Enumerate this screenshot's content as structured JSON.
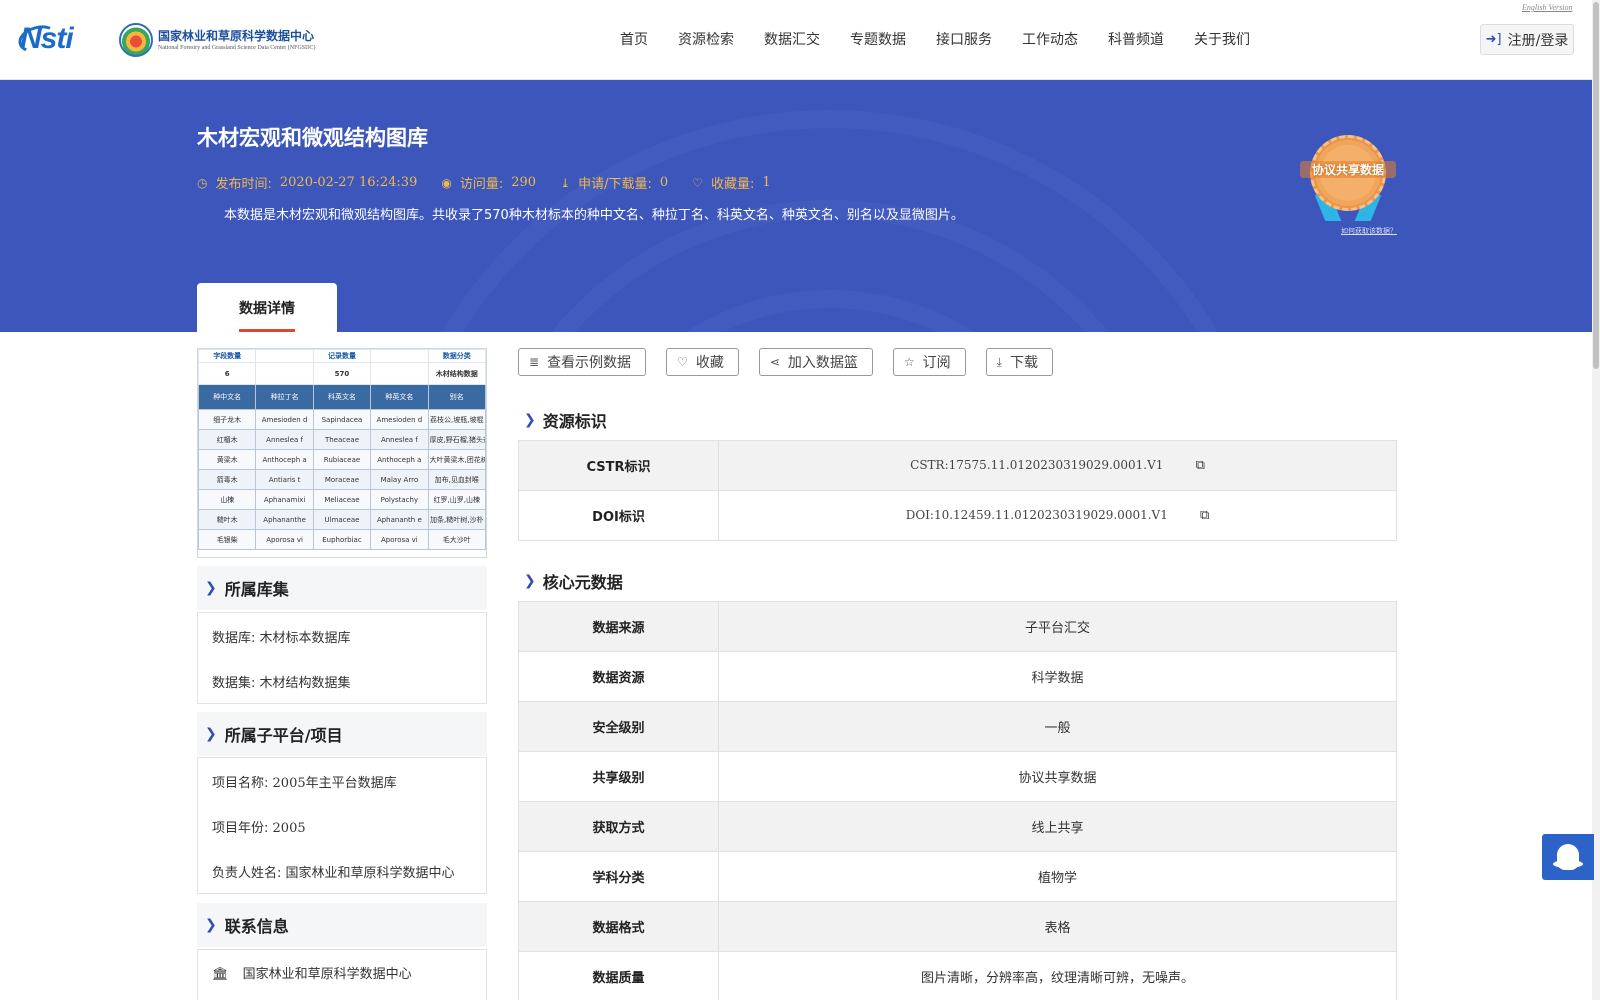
{
  "header": {
    "logo_nsti": "Nsti",
    "logo_cn": "国家林业和草原科学数据中心",
    "logo_en": "National Forestry and Grassland Science Data Center (NFGSDC)",
    "english_link": "English Version",
    "nav": [
      "首页",
      "资源检索",
      "数据汇交",
      "专题数据",
      "接口服务",
      "工作动态",
      "科普频道",
      "关于我们"
    ],
    "login_label": "注册/登录"
  },
  "banner": {
    "title": "木材宏观和微观结构图库",
    "publish_label": "发布时间:",
    "publish_value": "2020-02-27 16:24:39",
    "visits_label": "访问量:",
    "visits_value": "290",
    "downloads_label": "申请/下载量:",
    "downloads_value": "0",
    "favorites_label": "收藏量:",
    "favorites_value": "1",
    "description": "本数据是木材宏观和微观结构图库。共收录了570种木材标本的种中文名、种拉丁名、科英文名、种英文名、别名以及显微图片。",
    "badge_text": "协议共享数据",
    "badge_link": "如何获取该数据？",
    "tab_label": "数据详情"
  },
  "thumbnail": {
    "summary_labels": [
      "字段数量",
      "记录数量",
      "数据分类"
    ],
    "summary_values": [
      "6",
      "570",
      "木材结构数据"
    ],
    "headers": [
      "种中文名",
      "种拉丁名",
      "科英文名",
      "种英文名",
      "别名"
    ],
    "rows": [
      [
        "细子龙木",
        "Amesioden d",
        "Sapindacea",
        "Amesioden d",
        "荔枝公,坡瓶,坡棍"
      ],
      [
        "红楣木",
        "Anneslea f",
        "Theaceae",
        "Anneslea f",
        "厚皮,野石榴,猪头茶"
      ],
      [
        "黄梁木",
        "Anthoceph a",
        "Rubiaceae",
        "Anthoceph a",
        "大叶黄梁木,团花树"
      ],
      [
        "箭毒木",
        "Antiaris t",
        "Moraceae",
        "Malay Arro",
        "加布,见血封喉"
      ],
      [
        "山楝",
        "Aphanamixi",
        "Meliaceae",
        "Polystachy",
        "红罗,山罗,山楝"
      ],
      [
        "糙叶木",
        "Aphananthe",
        "Ulmaceae",
        "Aphananth e",
        "加条,糙叶树,沙朴"
      ],
      [
        "毛银柴",
        "Aporosa vi",
        "Euphorbiac",
        "Aporosa vi",
        "毛大沙叶"
      ]
    ]
  },
  "sidebar": {
    "library": {
      "title": "所属库集",
      "database_label": "数据库:",
      "database_value": "木材标本数据库",
      "dataset_label": "数据集:",
      "dataset_value": "木材结构数据集"
    },
    "project": {
      "title": "所属子平台/项目",
      "name_label": "项目名称:",
      "name_value": "2005年主平台数据库",
      "year_label": "项目年份:",
      "year_value": "2005",
      "owner_label": "负责人姓名:",
      "owner_value": "国家林业和草原科学数据中心"
    },
    "contact": {
      "title": "联系信息",
      "org": "国家林业和草原科学数据中心"
    }
  },
  "actions": [
    "查看示例数据",
    "收藏",
    "加入数据篮",
    "订阅",
    "下载"
  ],
  "identifiers": {
    "title": "资源标识",
    "rows": [
      {
        "key": "CSTR标识",
        "value": "CSTR:17575.11.0120230319029.0001.V1"
      },
      {
        "key": "DOI标识",
        "value": "DOI:10.12459.11.0120230319029.0001.V1"
      }
    ]
  },
  "core_meta": {
    "title": "核心元数据",
    "rows": [
      {
        "key": "数据来源",
        "value": "子平台汇交"
      },
      {
        "key": "数据资源",
        "value": "科学数据"
      },
      {
        "key": "安全级别",
        "value": "一般"
      },
      {
        "key": "共享级别",
        "value": "协议共享数据"
      },
      {
        "key": "获取方式",
        "value": "线上共享"
      },
      {
        "key": "学科分类",
        "value": "植物学"
      },
      {
        "key": "数据格式",
        "value": "表格"
      },
      {
        "key": "数据质量",
        "value": "图片清晰，分辨率高，纹理清晰可辨，无噪声。"
      }
    ]
  },
  "colors": {
    "banner_bg": "#3c56bc",
    "meta_accent": "#f2b84b",
    "tab_underline": "#e0472e",
    "chevron": "#2f4bb8"
  }
}
